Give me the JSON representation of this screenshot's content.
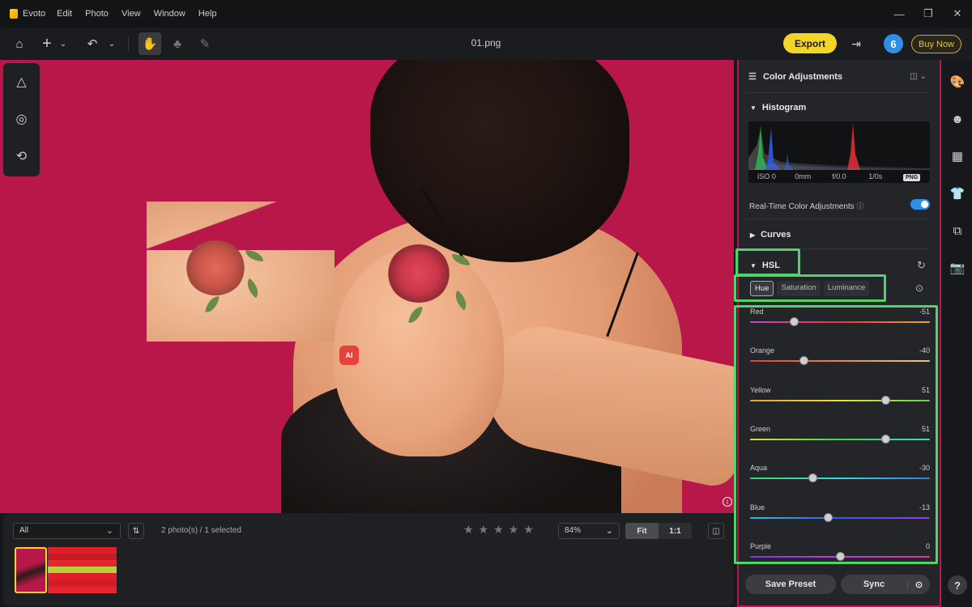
{
  "app": {
    "name": "Evoto",
    "menu": [
      "Edit",
      "Photo",
      "View",
      "Window",
      "Help"
    ]
  },
  "window_controls": {
    "minimize": "—",
    "restore": "❐",
    "close": "✕"
  },
  "toolbar": {
    "filename": "01.png",
    "export_label": "Export",
    "badge_count": "6",
    "buy_label": "Buy Now"
  },
  "canvas": {
    "background_color": "#b8174a",
    "ai_badge": "AI"
  },
  "filmstrip": {
    "filter_value": "All",
    "photo_count": "2 photo(s) / 1 selected",
    "stars": "★★★★★",
    "zoom_value": "84%",
    "fit_label": "Fit",
    "one_to_one_label": "1:1"
  },
  "panel": {
    "title": "Color Adjustments",
    "histogram": {
      "title": "Histogram",
      "iso": "ISO 0",
      "focal": "0mm",
      "aperture": "f/0.0",
      "shutter": "1/0s",
      "format": "PNG"
    },
    "realtime_label": "Real-Time Color Adjustments",
    "realtime_on": true,
    "curves_title": "Curves",
    "hsl": {
      "title": "HSL",
      "tabs": [
        "Hue",
        "Saturation",
        "Luminance"
      ],
      "active_tab": "Hue",
      "sliders": [
        {
          "label": "Red",
          "value": "-51"
        },
        {
          "label": "Orange",
          "value": "-40"
        },
        {
          "label": "Yellow",
          "value": "51"
        },
        {
          "label": "Green",
          "value": "51"
        },
        {
          "label": "Aqua",
          "value": "-30"
        },
        {
          "label": "Blue",
          "value": "-13"
        },
        {
          "label": "Purple",
          "value": "0"
        }
      ]
    },
    "save_preset_label": "Save Preset",
    "sync_label": "Sync"
  },
  "colors": {
    "accent_yellow": "#f3d52a",
    "highlight_green": "#4fd46b",
    "toggle_blue": "#2e8fe6"
  }
}
